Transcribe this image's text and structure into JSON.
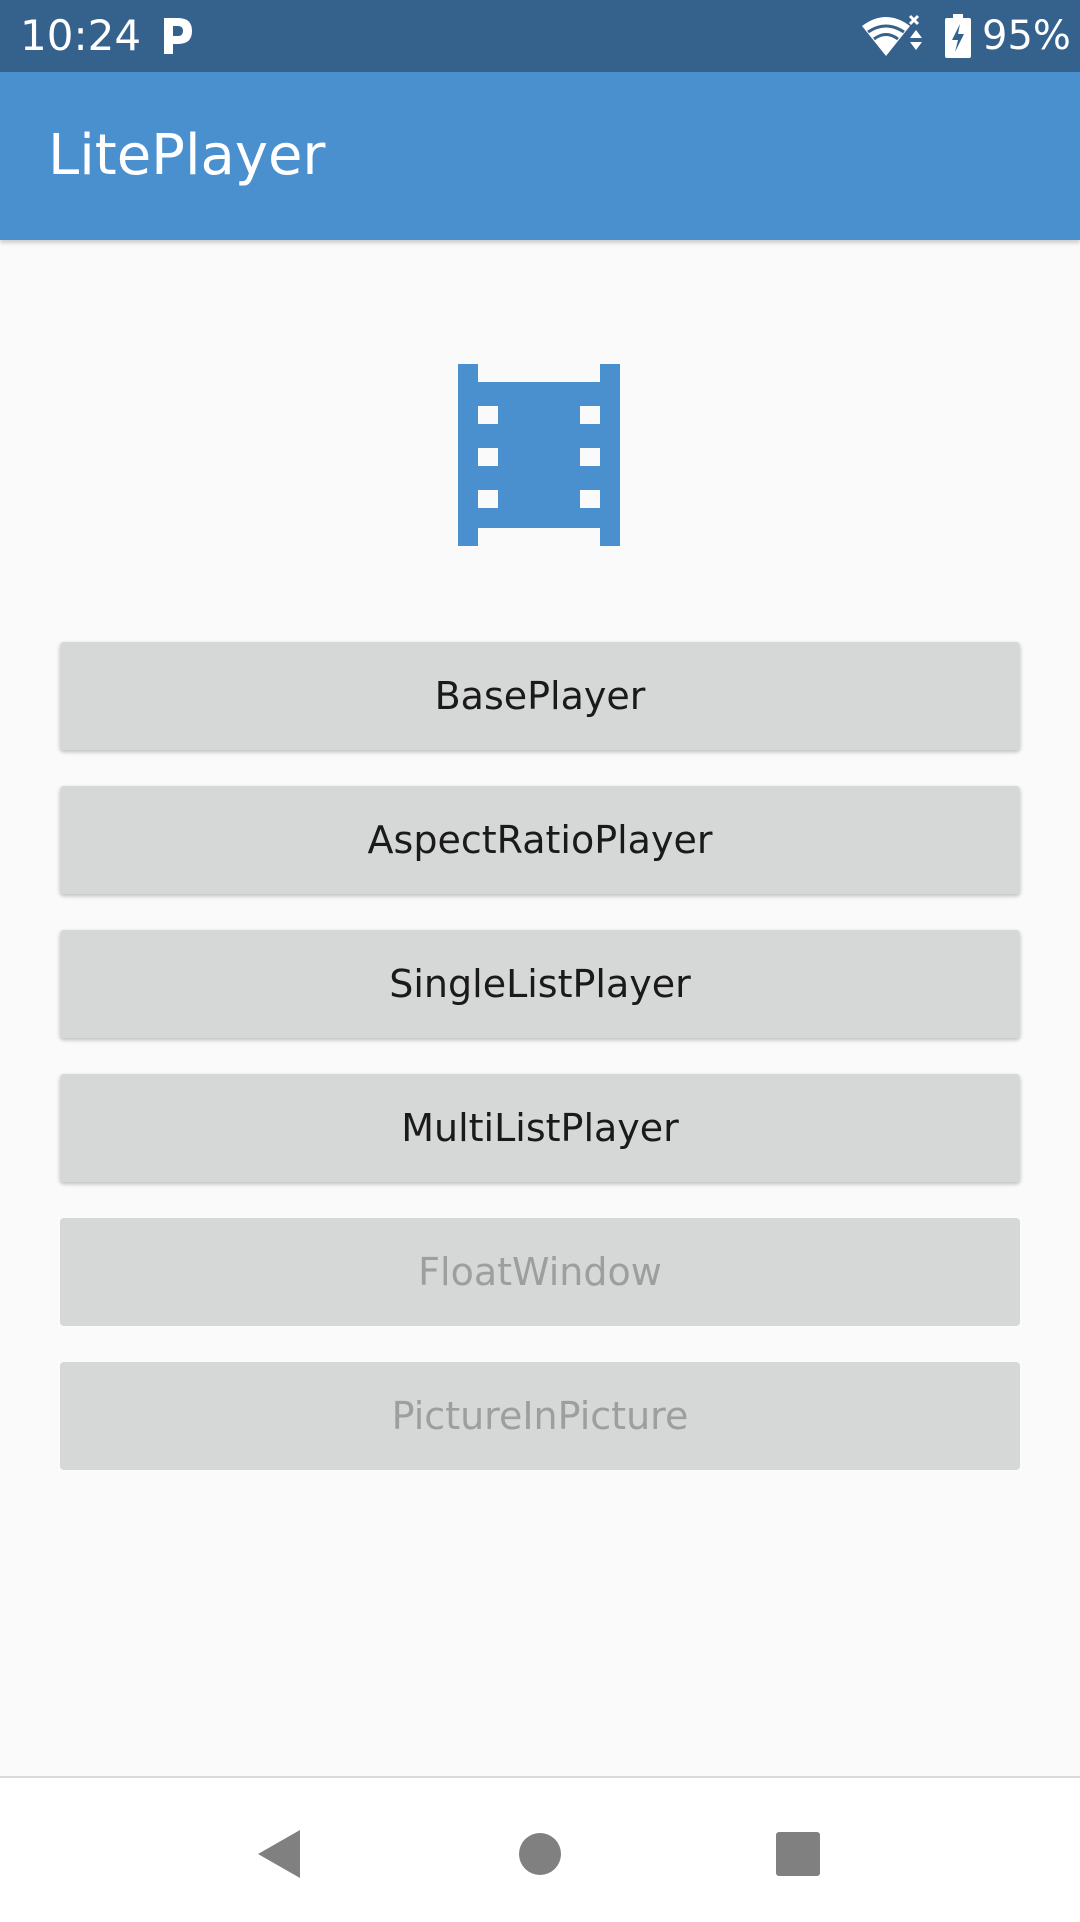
{
  "status_bar": {
    "time": "10:24",
    "battery_percent": "95%",
    "icons": [
      "parking-p-icon",
      "wifi-icon",
      "battery-charging-icon"
    ]
  },
  "app_bar": {
    "title": "LitePlayer",
    "color": "#4a90cf"
  },
  "logo": {
    "icon": "movie-filmstrip-icon",
    "color": "#4a90cf"
  },
  "buttons": [
    {
      "label": "BasePlayer",
      "enabled": true
    },
    {
      "label": "AspectRatioPlayer",
      "enabled": true
    },
    {
      "label": "SingleListPlayer",
      "enabled": true
    },
    {
      "label": "MultiListPlayer",
      "enabled": true
    },
    {
      "label": "FloatWindow",
      "enabled": false
    },
    {
      "label": "PictureInPicture",
      "enabled": false
    }
  ],
  "nav_bar": {
    "icons": [
      "back-icon",
      "home-icon",
      "recents-icon"
    ]
  },
  "colors": {
    "status_bar": "#34628c",
    "button_bg": "#d6d7d7",
    "button_text": "#1a1a1a",
    "button_disabled_text": "#9e9e9e",
    "background": "#fafafa"
  }
}
